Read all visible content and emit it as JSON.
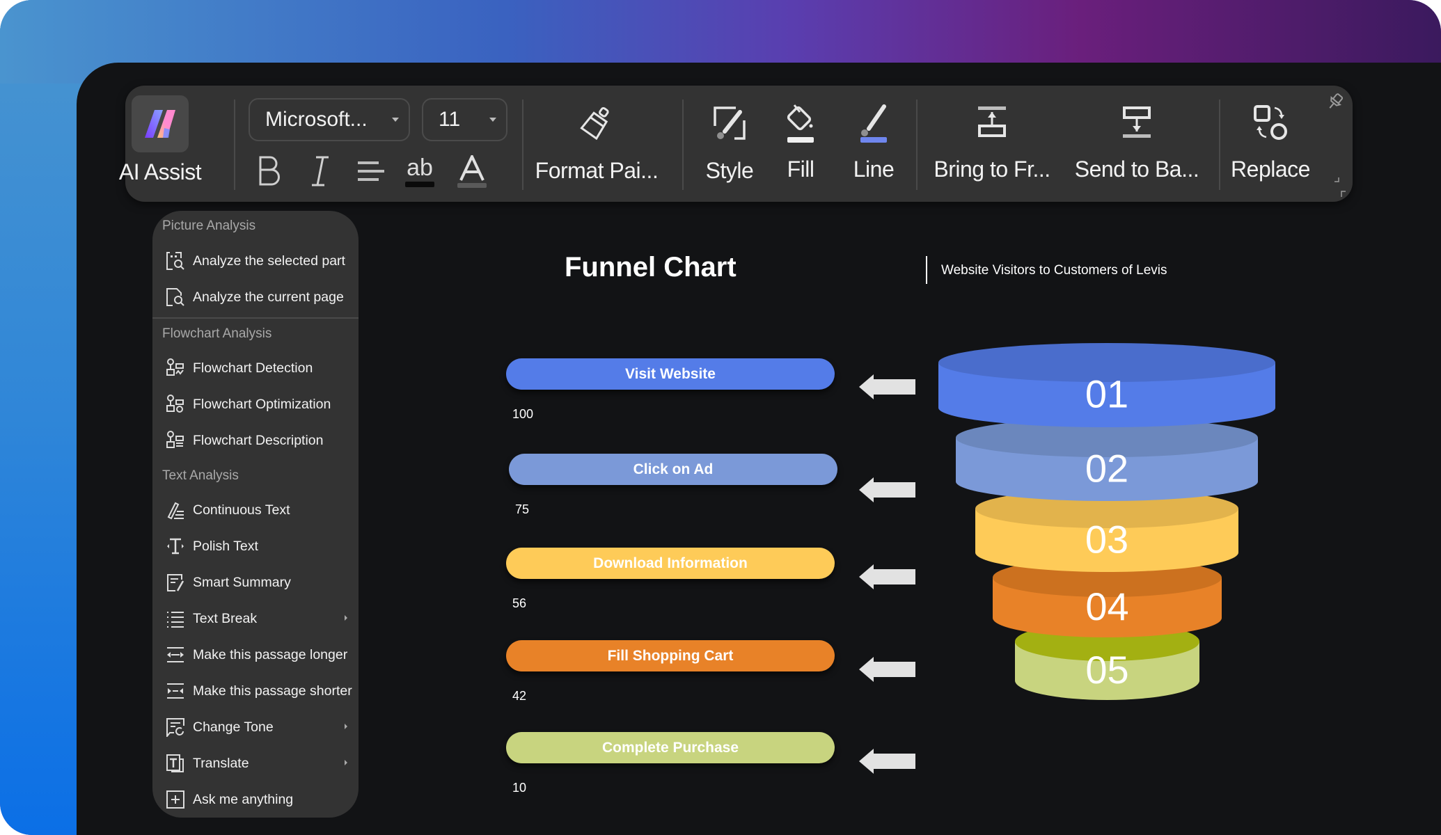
{
  "toolbar": {
    "ai_assist_label": "AI Assist",
    "font_name": "Microsoft...",
    "font_size": "11",
    "format_buttons": [
      "bold",
      "italic",
      "align",
      "highlight",
      "font-color"
    ],
    "format_painter_label": "Format Pai...",
    "style_label": "Style",
    "fill_label": "Fill",
    "line_label": "Line",
    "bring_front_label": "Bring to Fr...",
    "send_back_label": "Send to Ba...",
    "replace_label": "Replace",
    "line_color": "#6f86ee"
  },
  "menu": {
    "sections": [
      {
        "title": "Picture Analysis",
        "items": [
          {
            "label": "Analyze the selected part",
            "icon": "analyze-selection-icon"
          },
          {
            "label": "Analyze the current page",
            "icon": "analyze-page-icon"
          }
        ]
      },
      {
        "title": "Flowchart Analysis",
        "items": [
          {
            "label": "Flowchart Detection",
            "icon": "flowchart-detection-icon"
          },
          {
            "label": "Flowchart Optimization",
            "icon": "flowchart-optimization-icon"
          },
          {
            "label": "Flowchart Description",
            "icon": "flowchart-description-icon"
          }
        ]
      },
      {
        "title": "Text Analysis",
        "items": [
          {
            "label": "Continuous Text",
            "icon": "continuous-text-icon"
          },
          {
            "label": "Polish Text",
            "icon": "polish-text-icon"
          },
          {
            "label": "Smart Summary",
            "icon": "smart-summary-icon"
          },
          {
            "label": "Text Break",
            "icon": "text-break-icon",
            "submenu": true
          },
          {
            "label": "Make this passage longer",
            "icon": "make-longer-icon"
          },
          {
            "label": "Make this passage shorter",
            "icon": "make-shorter-icon"
          },
          {
            "label": "Change Tone",
            "icon": "change-tone-icon",
            "submenu": true
          },
          {
            "label": "Translate",
            "icon": "translate-icon",
            "submenu": true
          },
          {
            "label": "Ask me anything",
            "icon": "ask-anything-icon"
          }
        ]
      }
    ]
  },
  "chart_data": {
    "type": "funnel",
    "title": "Funnel Chart",
    "subtitle": "Website Visitors to Customers of Levis",
    "stages": [
      {
        "number": "01",
        "label": "Visit Website",
        "value": 100,
        "color": "#547ce8",
        "top_color": "#4a6dcc"
      },
      {
        "number": "02",
        "label": "Click on Ad",
        "value": 75,
        "color": "#7b99d8",
        "top_color": "#6b87bd"
      },
      {
        "number": "03",
        "label": "Download Information",
        "value": 56,
        "color": "#fecb58",
        "top_color": "#e2b34c"
      },
      {
        "number": "04",
        "label": "Fill Shopping Cart",
        "value": 42,
        "color": "#e88228",
        "top_color": "#cc711f"
      },
      {
        "number": "05",
        "label": "Complete Purchase",
        "value": 10,
        "color": "#c8d47f",
        "top_color": "#a3b012"
      }
    ]
  }
}
